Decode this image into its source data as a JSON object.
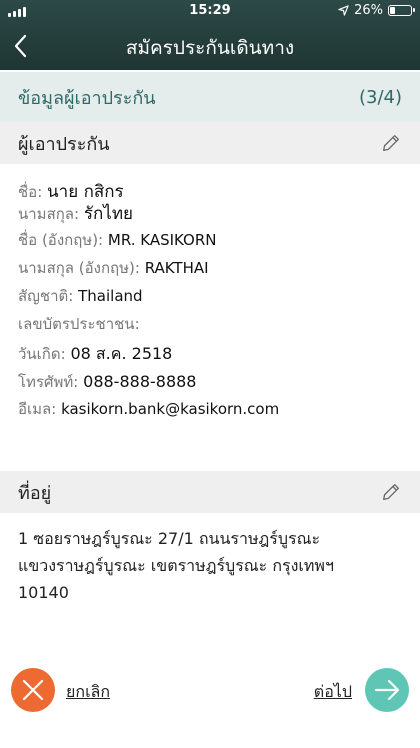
{
  "status_bar": {
    "time": "15:29",
    "battery_text": "26%",
    "battery_level": 0.26
  },
  "header": {
    "title": "สมัครประกันเดินทาง",
    "back_icon": "chevron-left-icon"
  },
  "step": {
    "label": "ข้อมูลผู้เอาประกัน",
    "progress": "(3/4)"
  },
  "insured": {
    "heading": "ผู้เอาประกัน",
    "fields": [
      {
        "label": "ชื่อ:",
        "value": "นาย กสิกร"
      },
      {
        "label": "นามสกุล:",
        "value": "รักไทย"
      },
      {
        "label": "ชื่อ (อังกฤษ):",
        "value": "MR. KASIKORN"
      },
      {
        "label": "นามสกุล (อังกฤษ):",
        "value": "RAKTHAI"
      },
      {
        "label": "สัญชาติ:",
        "value": "Thailand"
      },
      {
        "label": "เลขบัตรประชาชน:",
        "value": ""
      },
      {
        "label": "วันเกิด:",
        "value": "08 ส.ค. 2518"
      },
      {
        "label": "โทรศัพท์:",
        "value": "088-888-8888"
      },
      {
        "label": "อีเมล:",
        "value": "kasikorn.bank@kasikorn.com"
      }
    ]
  },
  "address": {
    "heading": "ที่อยู่",
    "lines": [
      "1 ซอยราษฎร์บูรณะ 27/1 ถนนราษฎร์บูรณะ",
      "แขวงราษฎร์บูรณะ เขตราษฎร์บูรณะ กรุงเทพฯ",
      "10140"
    ]
  },
  "footer": {
    "cancel_label": "ยกเลิก",
    "next_label": "ต่อไป"
  },
  "colors": {
    "header_bg": "#25403e",
    "accent_teal": "#2e6a66",
    "cancel": "#ee6a33",
    "next": "#5fc6b6"
  }
}
